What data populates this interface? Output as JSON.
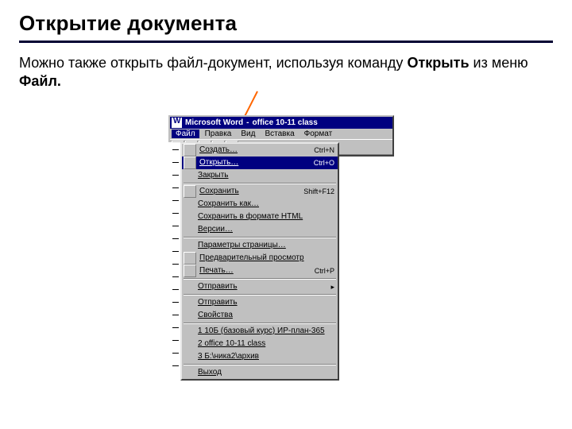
{
  "heading": "Открытие документа",
  "paragraph": {
    "prefix": "Можно также открыть файл-документ, используя команду ",
    "bold1": "Открыть",
    "mid": " из меню ",
    "bold2": "Файл.",
    "suffix": ""
  },
  "window": {
    "app": "Microsoft Word",
    "doc": "office 10-11 class"
  },
  "menubar": [
    "Файл",
    "Правка",
    "Вид",
    "Вставка",
    "Формат"
  ],
  "menu": [
    {
      "icon": true,
      "label": "Создать…",
      "shortcut": "Ctrl+N"
    },
    {
      "icon": true,
      "label": "Открыть…",
      "shortcut": "Ctrl+O",
      "hot": true
    },
    {
      "icon": false,
      "label": "Закрыть",
      "shortcut": ""
    },
    {
      "sep": true
    },
    {
      "icon": true,
      "label": "Сохранить",
      "shortcut": "Shift+F12"
    },
    {
      "icon": false,
      "label": "Сохранить как…",
      "shortcut": ""
    },
    {
      "icon": false,
      "label": "Сохранить в формате HTML",
      "shortcut": ""
    },
    {
      "icon": false,
      "label": "Версии…",
      "shortcut": ""
    },
    {
      "sep": true
    },
    {
      "icon": false,
      "label": "Параметры страницы…",
      "shortcut": ""
    },
    {
      "icon": true,
      "label": "Предварительный просмотр",
      "shortcut": ""
    },
    {
      "icon": true,
      "label": "Печать…",
      "shortcut": "Ctrl+P"
    },
    {
      "sep": true
    },
    {
      "icon": false,
      "label": "Отправить",
      "shortcut": "▸"
    },
    {
      "sep": true
    },
    {
      "icon": false,
      "label": "Отправить",
      "shortcut": ""
    },
    {
      "icon": false,
      "label": "Свойства",
      "shortcut": ""
    },
    {
      "sep": true
    },
    {
      "icon": false,
      "label": "1 10Б (базовый курс) ИР-план-365",
      "shortcut": ""
    },
    {
      "icon": false,
      "label": "2 office 10-11 class",
      "shortcut": ""
    },
    {
      "icon": false,
      "label": "3 Б:\\ника2\\архив",
      "shortcut": ""
    },
    {
      "sep": true
    },
    {
      "icon": false,
      "label": "Выход",
      "shortcut": ""
    }
  ],
  "colors": {
    "titlebar": "#000080",
    "arrow": "#ff6600"
  }
}
